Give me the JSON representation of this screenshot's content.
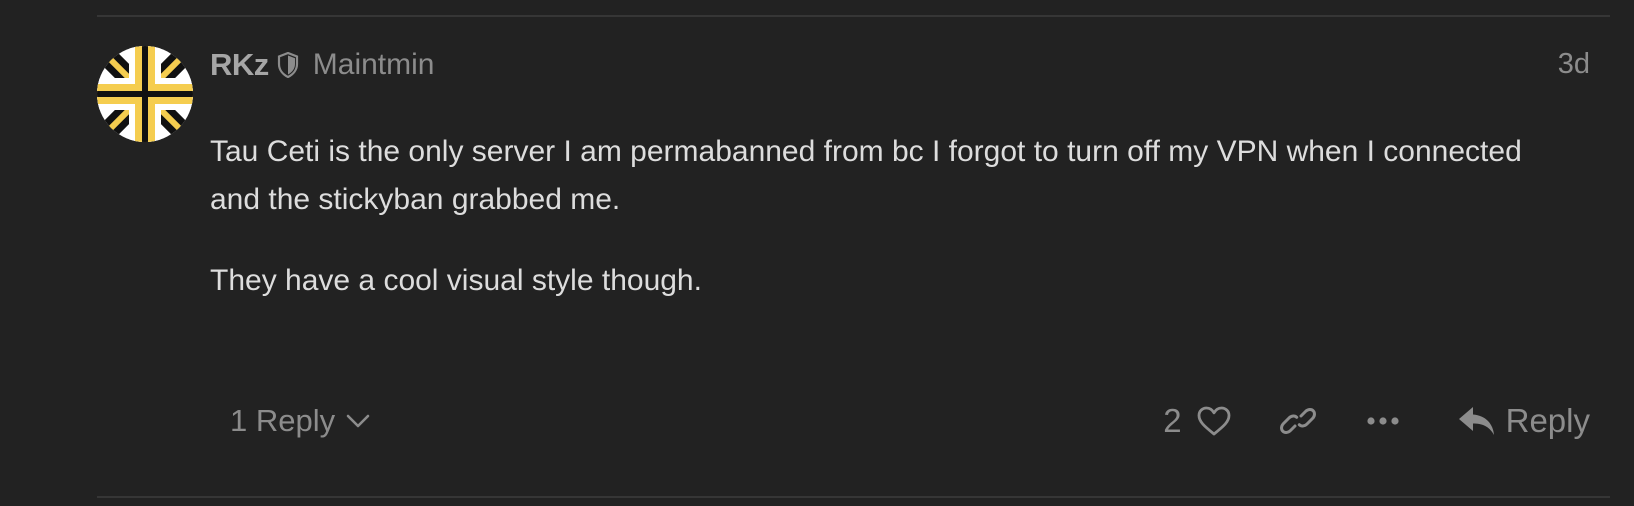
{
  "post": {
    "username": "RKz",
    "user_title": "Maintmin",
    "date": "3d",
    "body": [
      "Tau Ceti is the only server I am permabanned from bc I forgot to turn off my VPN when I connected and the stickyban grabbed me.",
      "They have a cool visual style though."
    ]
  },
  "controls": {
    "reply_count_label": "1 Reply",
    "like_count": "2",
    "reply_label": "Reply"
  },
  "icons": {
    "moderator": "shield-icon",
    "expand": "chevron-down-icon",
    "like": "heart-icon",
    "share": "link-icon",
    "more": "ellipsis-icon",
    "reply": "reply-arrow-icon"
  },
  "colors": {
    "background": "#222222",
    "muted": "#8c8c8c",
    "text": "#dddddd",
    "avatar_yellow": "#f5cd4f"
  }
}
